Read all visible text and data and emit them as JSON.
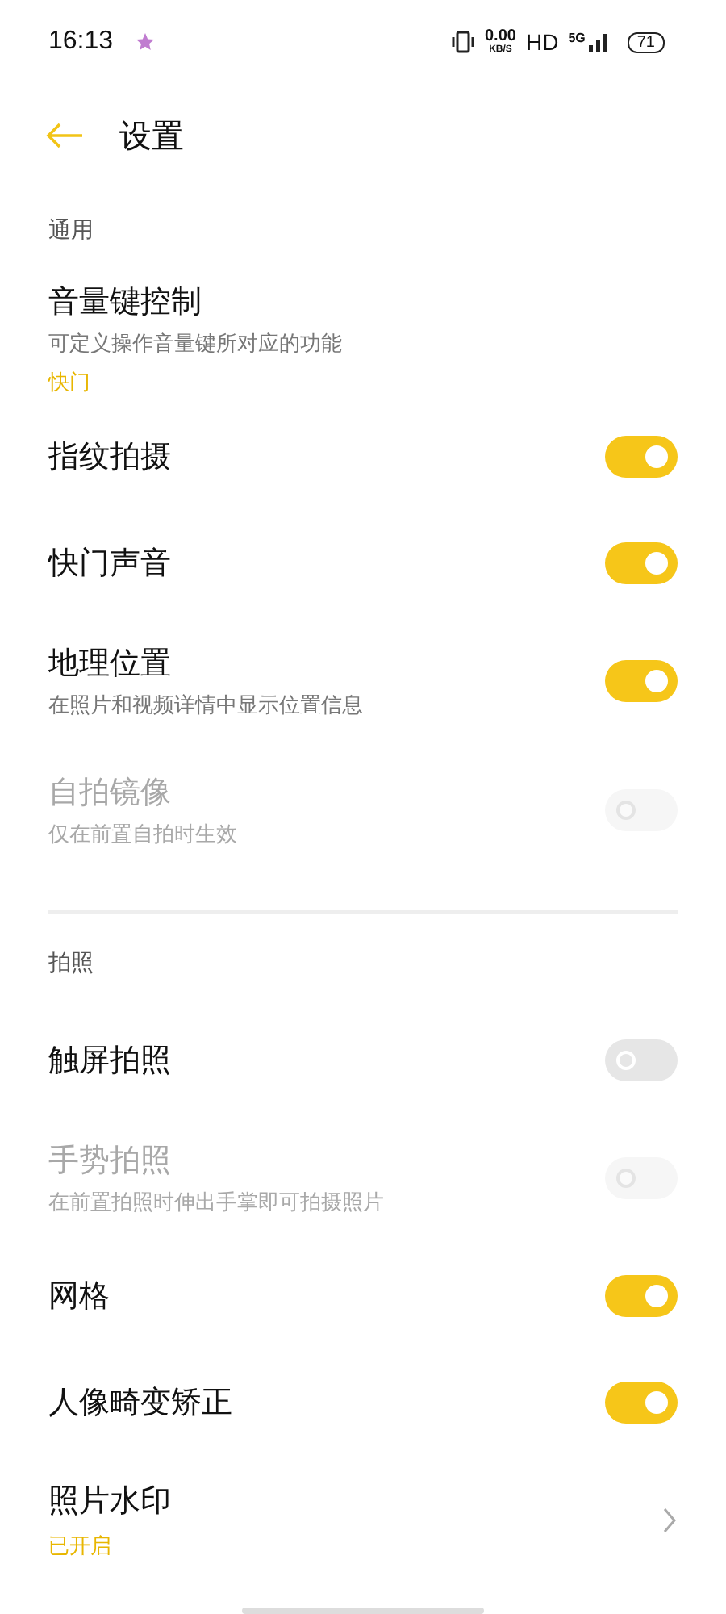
{
  "status_bar": {
    "time": "16:13",
    "speed": "0.00",
    "speed_unit": "KB/S",
    "hd": "HD",
    "network": "5G",
    "battery": "71"
  },
  "header": {
    "title": "设置"
  },
  "sections": [
    {
      "title": "通用",
      "items": [
        {
          "kind": "link",
          "label": "音量键控制",
          "description": "可定义操作音量键所对应的功能",
          "value": "快门"
        },
        {
          "kind": "switch",
          "label": "指纹拍摄",
          "on": true,
          "disabled": false
        },
        {
          "kind": "switch",
          "label": "快门声音",
          "on": true,
          "disabled": false
        },
        {
          "kind": "switch",
          "label": "地理位置",
          "description": "在照片和视频详情中显示位置信息",
          "on": true,
          "disabled": false
        },
        {
          "kind": "switch",
          "label": "自拍镜像",
          "description": "仅在前置自拍时生效",
          "on": false,
          "disabled": true
        }
      ]
    },
    {
      "title": "拍照",
      "items": [
        {
          "kind": "switch",
          "label": "触屏拍照",
          "on": false,
          "disabled": false
        },
        {
          "kind": "switch",
          "label": "手势拍照",
          "description": "在前置拍照时伸出手掌即可拍摄照片",
          "on": false,
          "disabled": true
        },
        {
          "kind": "switch",
          "label": "网格",
          "on": true,
          "disabled": false
        },
        {
          "kind": "switch",
          "label": "人像畸变矫正",
          "on": true,
          "disabled": false
        },
        {
          "kind": "chevron",
          "label": "照片水印",
          "value": "已开启"
        }
      ]
    }
  ]
}
